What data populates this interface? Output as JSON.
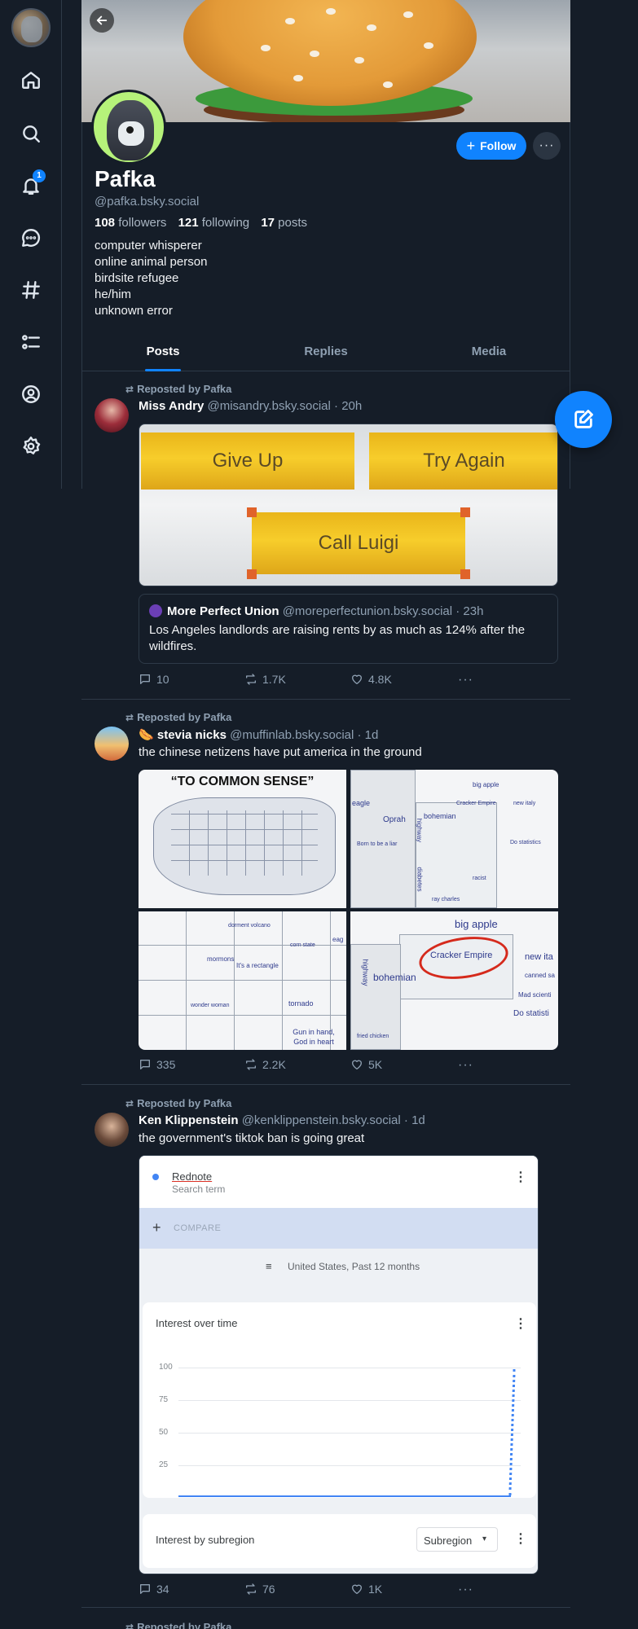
{
  "nav": {
    "items": [
      "home-icon",
      "search-icon",
      "notifications-icon",
      "chat-icon",
      "feeds-icon",
      "lists-icon",
      "profile-icon",
      "settings-icon"
    ],
    "notifications_count": "1"
  },
  "profile": {
    "name": "Pafka",
    "handle": "@pafka.bsky.social",
    "followers_count": "108",
    "followers_label": "followers",
    "following_count": "121",
    "following_label": "following",
    "posts_count": "17",
    "posts_label": "posts",
    "bio": [
      "computer whisperer",
      "online animal person",
      "birdsite refugee",
      "he/him",
      "unknown error"
    ],
    "follow_label": "Follow",
    "more_label": "···"
  },
  "tabs": [
    "Posts",
    "Replies",
    "Media"
  ],
  "posts": [
    {
      "repost_label": "Reposted by Pafka",
      "name": "Miss Andry",
      "handle": "@misandry.bsky.social",
      "time": "· 20h",
      "image_text": [
        "Give Up",
        "Try Again",
        "Call Luigi"
      ],
      "quote": {
        "name": "More Perfect Union",
        "handle": "@moreperfectunion.bsky.social",
        "time": "· 23h",
        "text": "Los Angeles landlords are raising rents by as much as 124% after the wildfires."
      },
      "replies": "10",
      "reposts": "1.7K",
      "likes": "4.8K"
    },
    {
      "repost_label": "Reposted by Pafka",
      "name": "stevia nicks",
      "handle": "@muffinlab.bsky.social",
      "time": "· 1d",
      "text": "the chinese netizens have put america in the ground",
      "image_text": {
        "title": "“TO COMMON SENSE”",
        "tr": [
          "big apple",
          "Oprah",
          "bohemian",
          "Cracker Empire",
          "new italy",
          "Do statistics",
          "eagle",
          "highway",
          "diabetes",
          "Born to be a liar",
          "racist",
          "ray charles"
        ],
        "bl": [
          "dorment volcano",
          "mormons",
          "It's a rectangle",
          "corn state",
          "wonder woman",
          "tornado",
          "Gun in hand, God in heart",
          "eag"
        ],
        "br": [
          "big apple",
          "Cracker Empire",
          "bohemian",
          "new ita",
          "canned sa",
          "Mad scienti",
          "Do statisti",
          "highway",
          "fried chicken"
        ]
      },
      "replies": "335",
      "reposts": "2.2K",
      "likes": "5K"
    },
    {
      "repost_label": "Reposted by Pafka",
      "name": "Ken Klippenstein",
      "handle": "@kenklippenstein.bsky.social",
      "time": "· 1d",
      "text": "the government's tiktok ban is going great",
      "trends": {
        "term": "Rednote",
        "term_sub": "Search term",
        "compare": "COMPARE",
        "filter": "United States, Past 12 months",
        "interest_title": "Interest over time",
        "y_ticks": [
          "100",
          "75",
          "50",
          "25"
        ],
        "subregion_title": "Interest by subregion",
        "subregion_select": "Subregion"
      },
      "replies": "34",
      "reposts": "76",
      "likes": "1K"
    },
    {
      "repost_label": "Reposted by Pafka"
    }
  ],
  "colors": {
    "accent": "#1083fe",
    "background": "#151d28",
    "border": "#2e3a48",
    "muted": "#8fa0b2"
  }
}
